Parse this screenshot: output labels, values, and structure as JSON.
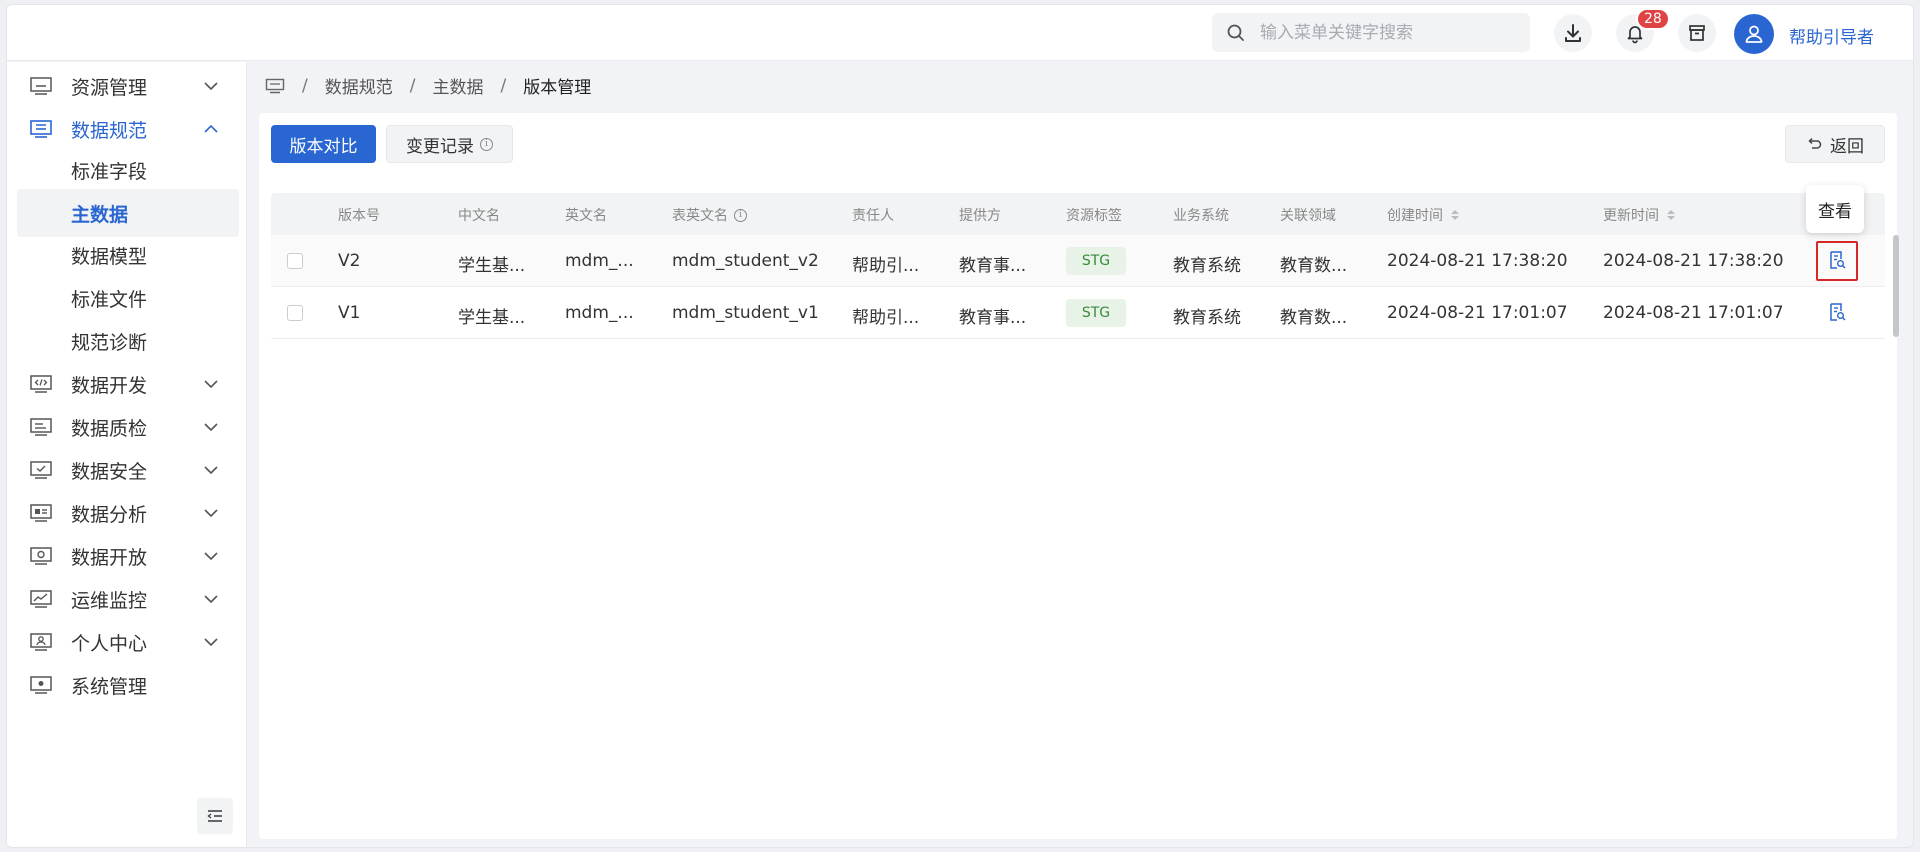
{
  "header": {
    "search_placeholder": "输入菜单关键字搜索",
    "notification_count": "28",
    "username": "帮助引导者"
  },
  "sidebar": {
    "items": [
      {
        "label": "资源管理",
        "icon": "monitor-icon",
        "state": "collapsed"
      },
      {
        "label": "数据规范",
        "icon": "database-icon",
        "state": "expanded"
      },
      {
        "label": "数据开发",
        "icon": "code-icon",
        "state": "collapsed"
      },
      {
        "label": "数据质检",
        "icon": "checklist-icon",
        "state": "collapsed"
      },
      {
        "label": "数据安全",
        "icon": "shield-monitor-icon",
        "state": "collapsed"
      },
      {
        "label": "数据分析",
        "icon": "chart-monitor-icon",
        "state": "collapsed"
      },
      {
        "label": "数据开放",
        "icon": "open-monitor-icon",
        "state": "collapsed"
      },
      {
        "label": "运维监控",
        "icon": "line-chart-icon",
        "state": "collapsed"
      },
      {
        "label": "个人中心",
        "icon": "user-card-icon",
        "state": "collapsed"
      },
      {
        "label": "系统管理",
        "icon": "gear-monitor-icon",
        "state": "collapsed"
      }
    ],
    "subitems": [
      {
        "label": "标准字段"
      },
      {
        "label": "主数据",
        "active": true
      },
      {
        "label": "数据模型"
      },
      {
        "label": "标准文件"
      },
      {
        "label": "规范诊断"
      }
    ]
  },
  "breadcrumb": {
    "items": [
      "数据规范",
      "主数据",
      "版本管理"
    ]
  },
  "toolbar": {
    "compare_label": "版本对比",
    "history_label": "变更记录",
    "back_label": "返回"
  },
  "table": {
    "headers": [
      "版本号",
      "中文名",
      "英文名",
      "表英文名",
      "责任人",
      "提供方",
      "资源标签",
      "业务系统",
      "关联领域",
      "创建时间",
      "更新时间"
    ],
    "rows": [
      [
        "V2",
        "学生基...",
        "mdm_...",
        "mdm_student_v2",
        "帮助引...",
        "教育事...",
        "STG",
        "教育系统",
        "教育数...",
        "2024-08-21 17:38:20",
        "2024-08-21 17:38:20"
      ],
      [
        "V1",
        "学生基...",
        "mdm_...",
        "mdm_student_v1",
        "帮助引...",
        "教育事...",
        "STG",
        "教育系统",
        "教育数...",
        "2024-08-21 17:01:07",
        "2024-08-21 17:01:07"
      ]
    ]
  },
  "tooltip": {
    "text": "查看"
  },
  "colors": {
    "primary": "#2a66d2",
    "tag_bg": "#e6f3e6",
    "tag_text": "#3a8a3a",
    "badge": "#e04343",
    "highlight": "#d62828"
  }
}
